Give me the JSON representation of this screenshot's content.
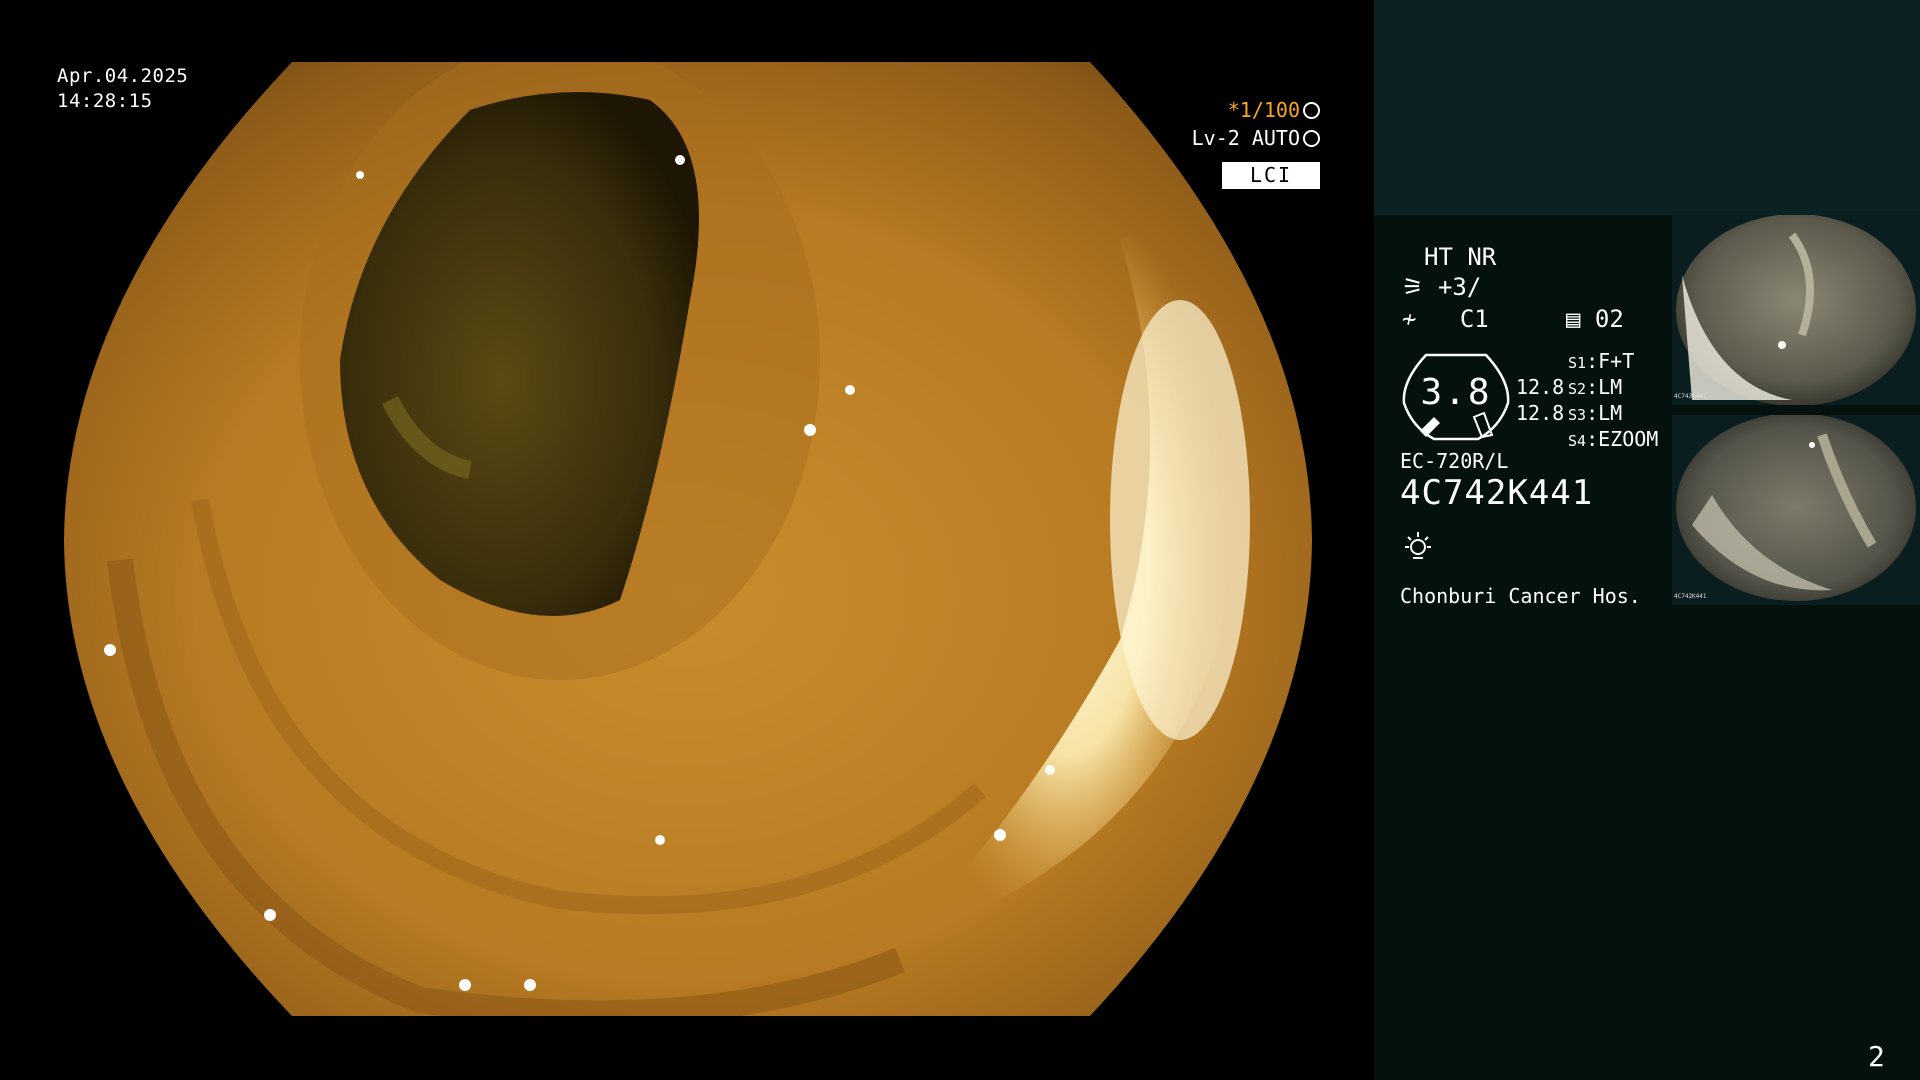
{
  "datetime": {
    "date": "Apr.04.2025",
    "time": "14:28:15"
  },
  "status": {
    "shutter": "*1/100",
    "iris": "Lv-2 AUTO",
    "mode_badge": "LCI"
  },
  "panel": {
    "structure": "HT NR",
    "enhance": "+3/",
    "color": "C1",
    "memo": "02",
    "dial_value": "3.8",
    "zoom_values": [
      "12.8",
      "12.8"
    ],
    "switches": [
      {
        "key": "S1",
        "value": "F+T"
      },
      {
        "key": "S2",
        "value": "LM"
      },
      {
        "key": "S3",
        "value": "LM"
      },
      {
        "key": "S4",
        "value": "EZOOM"
      }
    ],
    "scope_model": "EC-720R/L",
    "serial": "4C742K441",
    "hospital": "Chonburi Cancer Hos."
  },
  "thumbnails": [
    {
      "caption": "4C742K441"
    },
    {
      "caption": "4C742K441"
    }
  ],
  "page_number": "2",
  "colors": {
    "accent": "#f6a623",
    "panel_top": "#0c2124",
    "panel_bottom": "#05110f"
  }
}
